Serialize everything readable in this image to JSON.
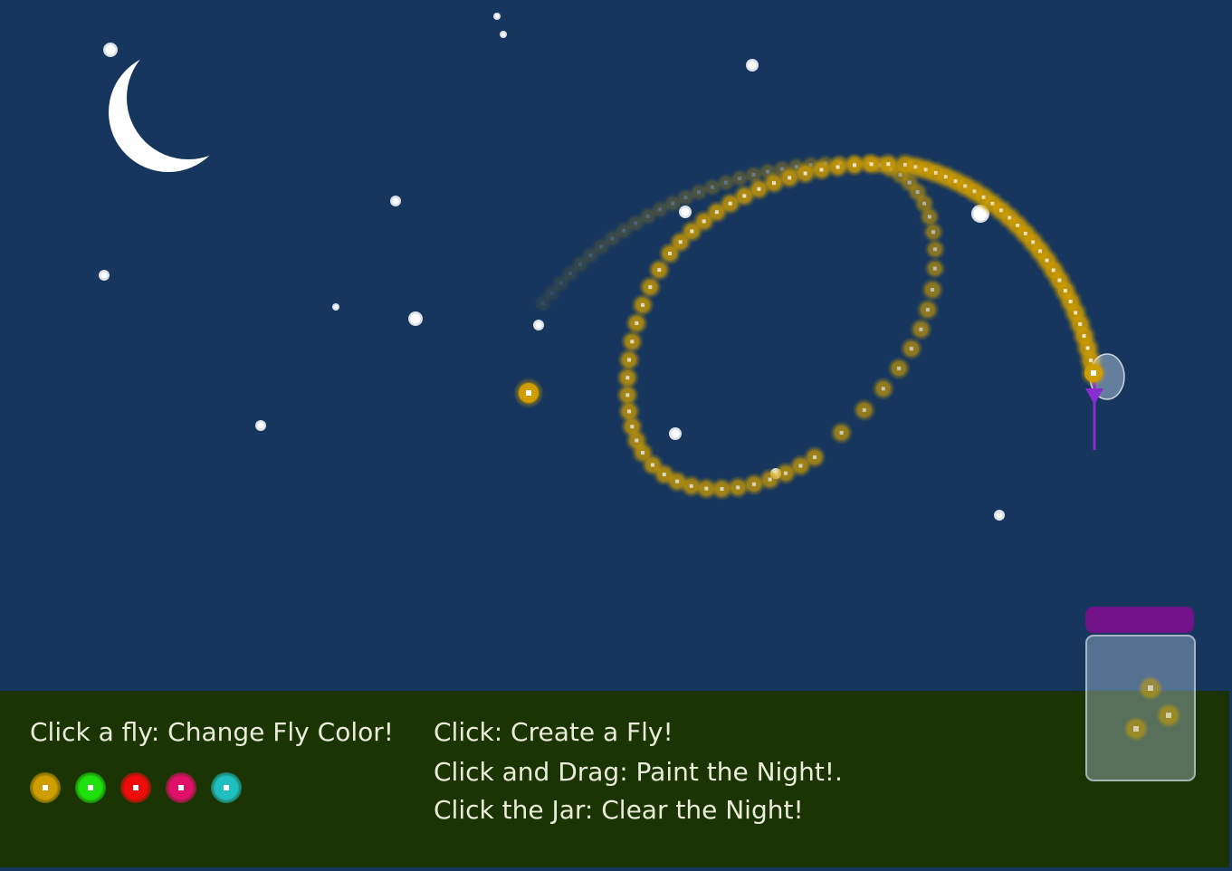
{
  "instructions": {
    "change_color": "Click a fly: Change Fly Color!",
    "create": "Click: Create a Fly!",
    "paint": "Click and Drag: Paint the Night!.",
    "clear": "Click the Jar: Clear the Night!"
  },
  "palette": [
    {
      "name": "gold-swatch",
      "color": "#cf9d00"
    },
    {
      "name": "green-swatch",
      "color": "#1ee00d"
    },
    {
      "name": "red-swatch",
      "color": "#ee0b0b"
    },
    {
      "name": "pink-swatch",
      "color": "#e01068"
    },
    {
      "name": "cyan-swatch",
      "color": "#1fbfbf"
    }
  ],
  "colors": {
    "sky": "#16365d",
    "ground": "#1b3403",
    "fly": "#cf9d00",
    "jar_lid": "#721289",
    "stinger": "#8a2dd0",
    "moon": "#ffffff",
    "text": "#e8ecd8"
  },
  "icons": {
    "moon": "crescent-moon-icon",
    "star": "star-icon",
    "fly": "firefly-icon",
    "jar": "jar-icon"
  }
}
